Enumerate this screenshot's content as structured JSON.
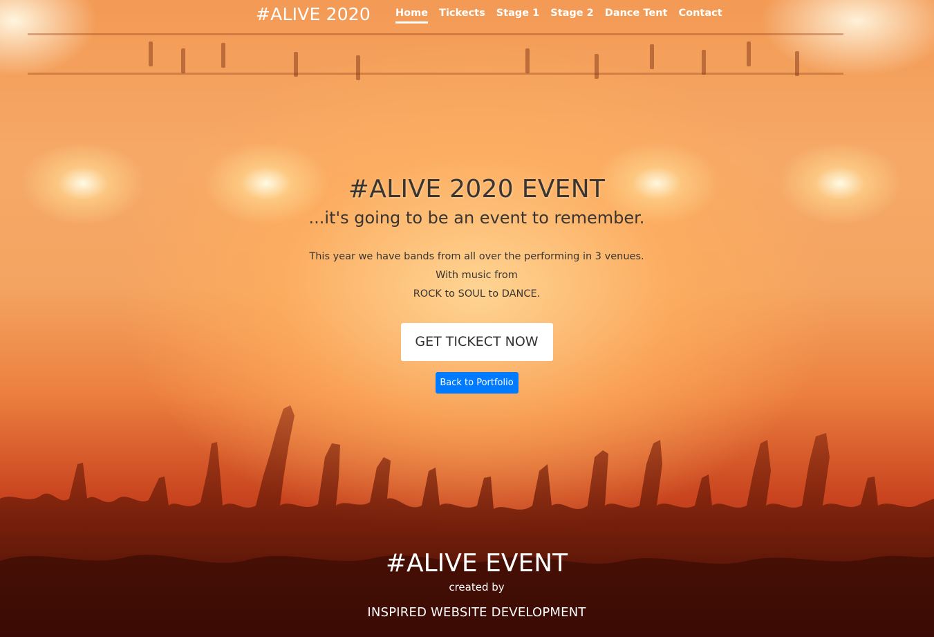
{
  "navbar": {
    "brand": "#ALIVE 2020",
    "links": [
      {
        "label": "Home",
        "active": true
      },
      {
        "label": "Tickects",
        "active": false
      },
      {
        "label": "Stage 1",
        "active": false
      },
      {
        "label": "Stage 2",
        "active": false
      },
      {
        "label": "Dance Tent",
        "active": false
      },
      {
        "label": "Contact",
        "active": false
      }
    ]
  },
  "hero": {
    "title": "#ALIVE 2020 EVENT",
    "subtitle": "...it's going to be an event to remember.",
    "description_lines": [
      "This year we have bands from all over the performing in 3 venues.",
      "With music from",
      "ROCK to SOUL to DANCE."
    ],
    "cta_label": "GET TICKECT NOW",
    "back_label": "Back to Portfolio"
  },
  "footer": {
    "title": "#ALIVE EVENT",
    "created_by": "created by",
    "company": "INSPIRED WEBSITE DEVELOPMENT"
  },
  "colors": {
    "back_button": "#007bff",
    "cta_background": "#ffffff",
    "background_primary": "#f39a55",
    "crowd_dark": "#5a1508"
  },
  "background_image": "concert-crowd-stage-lights"
}
